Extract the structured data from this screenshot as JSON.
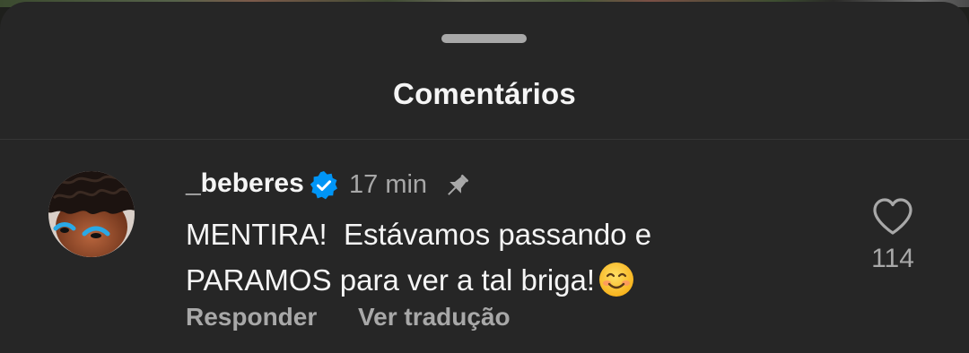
{
  "sheet": {
    "title": "Comentários"
  },
  "comment": {
    "username": "_beberes",
    "verified": true,
    "time": "17 min",
    "pinned": true,
    "text_line1": "MENTIRA!  Estávamos passando e",
    "text_line2": "PARAMOS para ver a tal briga!",
    "emoji": "smiling-face-emoji",
    "reply_label": "Responder",
    "translate_label": "Ver tradução",
    "like_count": "114"
  },
  "icons": {
    "verified": "verified-badge-icon",
    "pin": "pin-icon",
    "like": "heart-outline-icon"
  },
  "colors": {
    "background": "#262626",
    "text_primary": "#f5f5f5",
    "text_secondary": "#a8a8a8",
    "verified_blue": "#0095f6"
  }
}
